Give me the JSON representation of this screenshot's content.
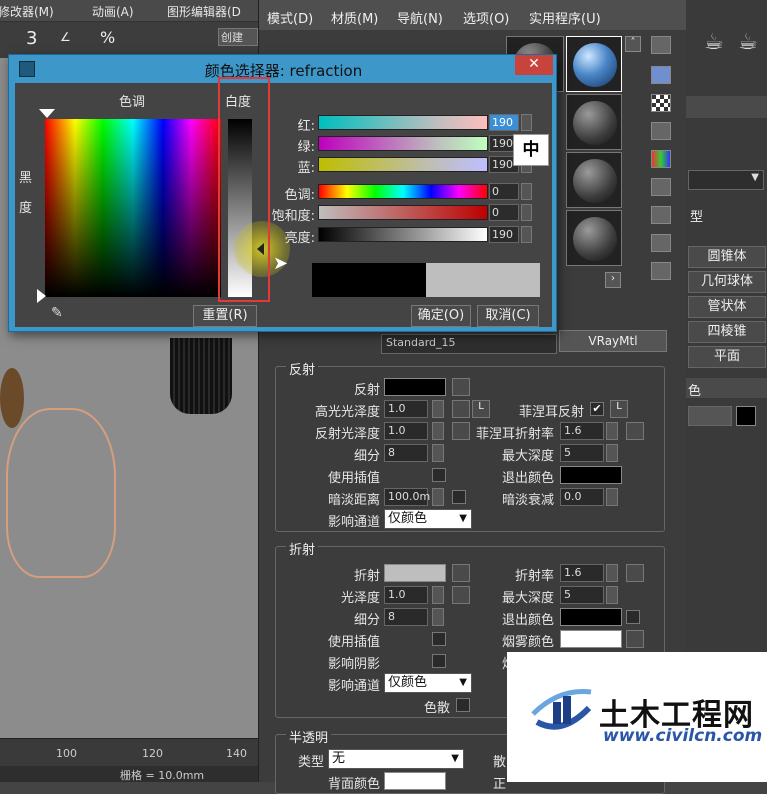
{
  "max_menu": [
    "修改器(M)",
    "动画(A)",
    "图形编辑器(D"
  ],
  "max_toolbar": {
    "snap_label": "3",
    "create_btn": "创建"
  },
  "ruler_ticks": [
    "100",
    "120",
    "140"
  ],
  "status": {
    "grid": "栅格 = 10.0mm"
  },
  "material_editor": {
    "menu": [
      "模式(D)",
      "材质(M)",
      "导航(N)",
      "选项(O)",
      "实用程序(U)"
    ],
    "material_name": "Standard_15",
    "type_button": "VRayMtl",
    "reflection": {
      "title": "反射",
      "labels": {
        "reflect": "反射",
        "hilight_gloss": "高光光泽度",
        "refl_gloss": "反射光泽度",
        "subdivs": "细分",
        "use_interp": "使用插值",
        "dim_dist": "暗淡距离",
        "affect_channels": "影响通道",
        "fresnel": "菲涅耳反射",
        "fresnel_ior": "菲涅耳折射率",
        "max_depth": "最大深度",
        "exit_color": "退出颜色",
        "dim_falloff": "暗淡衰减"
      },
      "values": {
        "hilight_gloss": "1.0",
        "refl_gloss": "1.0",
        "subdivs": "8",
        "dim_dist": "100.0m",
        "fresnel_ior": "1.6",
        "max_depth": "5",
        "dim_falloff": "0.0",
        "affect_channels": "仅颜色",
        "L": "L"
      }
    },
    "refraction": {
      "title": "折射",
      "labels": {
        "refract": "折射",
        "gloss": "光泽度",
        "subdivs": "细分",
        "use_interp": "使用插值",
        "affect_shadows": "影响阴影",
        "affect_channels": "影响通道",
        "ior": "折射率",
        "max_depth": "最大深度",
        "exit_color": "退出颜色",
        "fog_color": "烟雾颜色",
        "fog_mult": "烟雾倍增",
        "fog_bias": "烟",
        "dispersion": "色散"
      },
      "values": {
        "gloss": "1.0",
        "subdivs": "8",
        "ior": "1.6",
        "max_depth": "5",
        "affect_channels": "仅颜色"
      }
    },
    "translucency": {
      "title": "半透明",
      "type_label": "类型",
      "type_value": "无",
      "back_color": "背面颜色",
      "extra": "散",
      "extra2": "正"
    }
  },
  "command_panel": {
    "buttons": [
      "圆锥体",
      "几何球体",
      "管状体",
      "四棱锥",
      "平面"
    ],
    "color_label": "色",
    "section": "型"
  },
  "color_picker": {
    "title": "颜色选择器: refraction",
    "hue_label": "色调",
    "whiteness_label": "白度",
    "black_label": "黑",
    "degree_label": "度",
    "channels": [
      {
        "label": "红:",
        "value": "190"
      },
      {
        "label": "绿:",
        "value": "190"
      },
      {
        "label": "蓝:",
        "value": "190"
      },
      {
        "label": "色调:",
        "value": "0"
      },
      {
        "label": "饱和度:",
        "value": "0"
      },
      {
        "label": "亮度:",
        "value": "190"
      }
    ],
    "reset_button": "重置(R)",
    "ok_button": "确定(O)",
    "cancel_button": "取消(C)",
    "ime_indicator": "中",
    "close_glyph": "✕",
    "colors": {
      "old": "#000000",
      "new": "#bebebe"
    }
  },
  "watermark": {
    "name": "土木工程网",
    "url": "www.civilcn.com"
  }
}
